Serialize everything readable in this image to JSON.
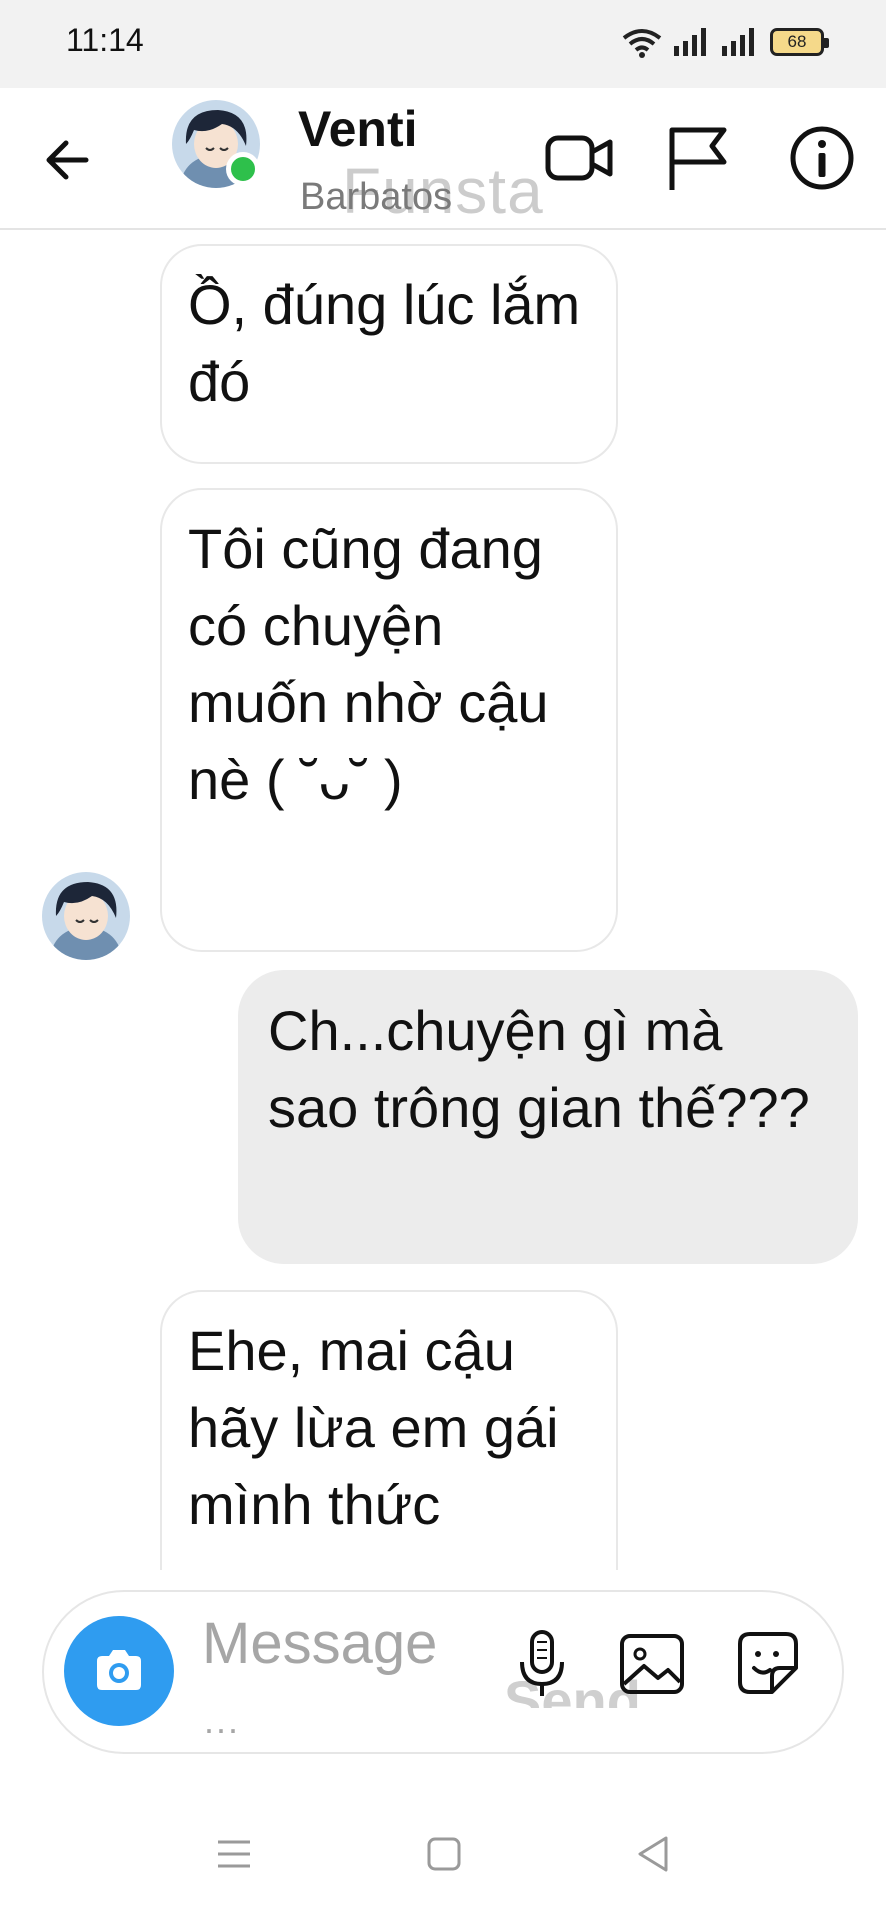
{
  "status": {
    "time": "11:14",
    "battery": "68"
  },
  "header": {
    "contact_name": "Venti",
    "contact_subtitle": "Barbatos",
    "watermark": "Funsta"
  },
  "messages": [
    {
      "sender": "contact",
      "text": "Ồ, đúng lúc lắm đó"
    },
    {
      "sender": "contact",
      "text": "Tôi cũng đang có chuyện muốn nhờ cậu nè ( ˘ᴗ˘ )"
    },
    {
      "sender": "me",
      "text": "Ch...chuyện gì mà sao trông gian thế???"
    },
    {
      "sender": "contact",
      "text": "Ehe, mai cậu hãy lừa em gái mình thức"
    }
  ],
  "composer": {
    "placeholder": "Message",
    "ellipsis": "...",
    "send_label": "Send"
  },
  "icons": {
    "back": "arrow-left-icon",
    "video": "video-camera-icon",
    "report": "flag-icon",
    "info": "info-icon",
    "camera": "camera-icon",
    "mic": "microphone-icon",
    "gallery": "image-icon",
    "sticker": "sticker-icon"
  },
  "colors": {
    "online": "#2ec04b",
    "camera_button": "#2f9cf0",
    "outgoing_bubble": "#ececec"
  }
}
